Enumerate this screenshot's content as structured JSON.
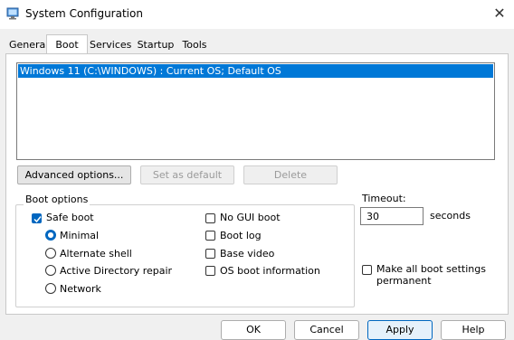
{
  "window": {
    "title": "System Configuration"
  },
  "tabs": [
    "General",
    "Boot",
    "Services",
    "Startup",
    "Tools"
  ],
  "active_tab": "Boot",
  "os_list": [
    "Windows 11 (C:\\WINDOWS) : Current OS; Default OS"
  ],
  "buttons": {
    "advanced": "Advanced options...",
    "set_default": "Set as default",
    "delete": "Delete"
  },
  "boot_options": {
    "label": "Boot options",
    "safe_boot": {
      "label": "Safe boot",
      "checked": true
    },
    "radios": [
      {
        "label": "Minimal",
        "checked": true
      },
      {
        "label": "Alternate shell",
        "checked": false
      },
      {
        "label": "Active Directory repair",
        "checked": false
      },
      {
        "label": "Network",
        "checked": false
      }
    ],
    "right_checks": [
      {
        "label": "No GUI boot",
        "checked": false
      },
      {
        "label": "Boot log",
        "checked": false
      },
      {
        "label": "Base video",
        "checked": false
      },
      {
        "label": "OS boot information",
        "checked": false
      }
    ]
  },
  "timeout": {
    "label": "Timeout:",
    "value": "30",
    "unit": "seconds"
  },
  "make_permanent": {
    "label_line1": "Make all boot settings",
    "label_line2": "permanent",
    "checked": false
  },
  "footer": {
    "ok": "OK",
    "cancel": "Cancel",
    "apply": "Apply",
    "help": "Help"
  },
  "colors": {
    "accent": "#0067c0",
    "selection": "#0078d7"
  },
  "icons": {
    "app": "system-config-icon",
    "close": "close-icon"
  }
}
